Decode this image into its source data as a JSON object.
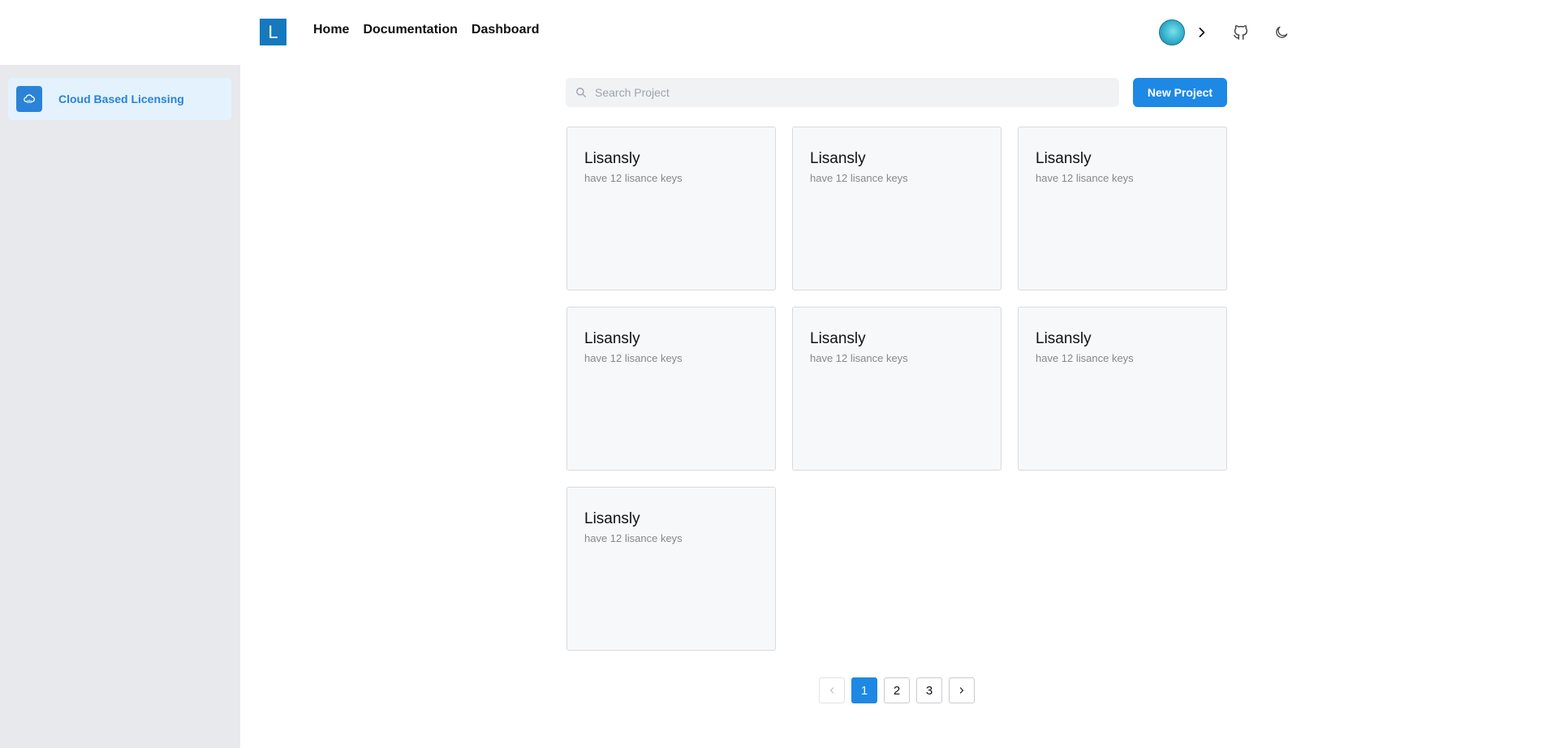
{
  "header": {
    "logo_letter": "L",
    "nav": [
      "Home",
      "Documentation",
      "Dashboard"
    ],
    "icons": [
      "avatar",
      "chevron-right-icon",
      "github-icon",
      "moon-icon"
    ]
  },
  "sidebar": {
    "items": [
      {
        "label": "Cloud Based Licensing",
        "icon": "cloud-icon"
      }
    ]
  },
  "search": {
    "placeholder": "Search Project"
  },
  "toolbar": {
    "new_project_label": "New Project"
  },
  "projects": [
    {
      "title": "Lisansly",
      "subtitle": "have 12 lisance keys"
    },
    {
      "title": "Lisansly",
      "subtitle": "have 12 lisance keys"
    },
    {
      "title": "Lisansly",
      "subtitle": "have 12 lisance keys"
    },
    {
      "title": "Lisansly",
      "subtitle": "have 12 lisance keys"
    },
    {
      "title": "Lisansly",
      "subtitle": "have 12 lisance keys"
    },
    {
      "title": "Lisansly",
      "subtitle": "have 12 lisance keys"
    },
    {
      "title": "Lisansly",
      "subtitle": "have 12 lisance keys"
    }
  ],
  "pagination": {
    "pages": [
      "1",
      "2",
      "3"
    ],
    "current": "1"
  },
  "colors": {
    "accent": "#1e88e5",
    "sidebar_bg": "#e7e9ec",
    "sidebar_active_bg": "#e3f2fd"
  }
}
